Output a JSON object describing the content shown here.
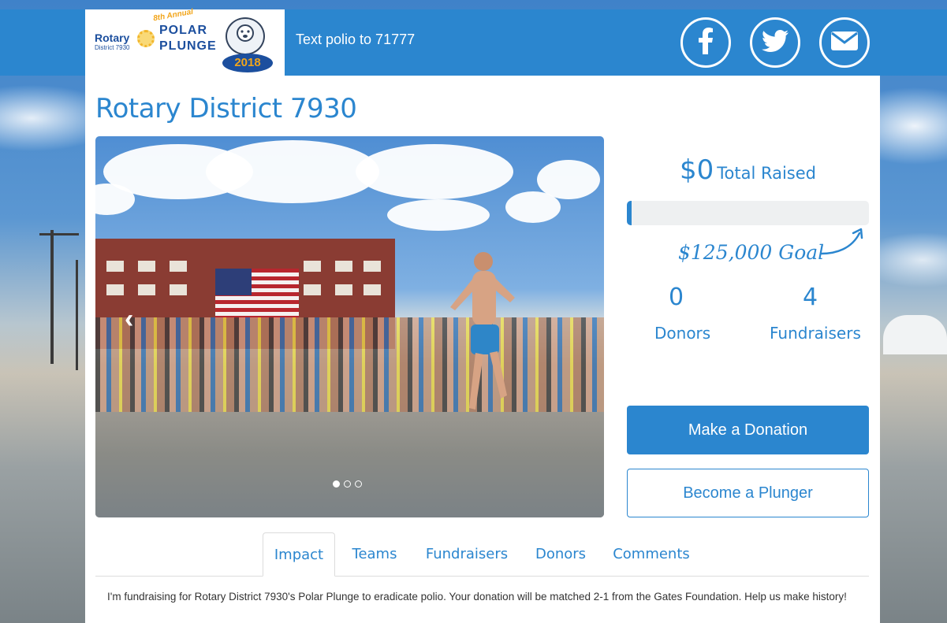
{
  "header": {
    "logo": {
      "org": "Rotary",
      "district": "District 7930",
      "annual": "8th Annual",
      "event_line1": "POLAR",
      "event_line2": "PLUNGE",
      "year": "2018"
    },
    "text_polio": "Text polio to 71777",
    "social": [
      {
        "icon": "facebook-icon",
        "glyph": "f"
      },
      {
        "icon": "twitter-icon",
        "glyph": "twitter"
      },
      {
        "icon": "email-icon",
        "glyph": "envelope"
      }
    ]
  },
  "page": {
    "title": "Rotary District 7930"
  },
  "carousel": {
    "slides": 3,
    "active_slide": 1
  },
  "stats": {
    "total_amount": "$0",
    "total_label": "Total Raised",
    "progress_fraction": 0.02,
    "goal_amount": "$125,000",
    "goal_label": "Goal",
    "donors_count": "0",
    "donors_label": "Donors",
    "fundraisers_count": "4",
    "fundraisers_label": "Fundraisers"
  },
  "actions": {
    "donate_label": "Make a Donation",
    "plunger_label": "Become a Plunger"
  },
  "tabs": [
    {
      "label": "Impact",
      "active": true
    },
    {
      "label": "Teams",
      "active": false
    },
    {
      "label": "Fundraisers",
      "active": false
    },
    {
      "label": "Donors",
      "active": false
    },
    {
      "label": "Comments",
      "active": false
    }
  ],
  "impact": {
    "text": "I'm fundraising for Rotary District 7930's Polar Plunge to eradicate polio. Your donation will be matched 2-1 from the Gates Foundation. Help us make history!"
  },
  "colors": {
    "brand_blue": "#2b86cf",
    "white": "#ffffff"
  }
}
